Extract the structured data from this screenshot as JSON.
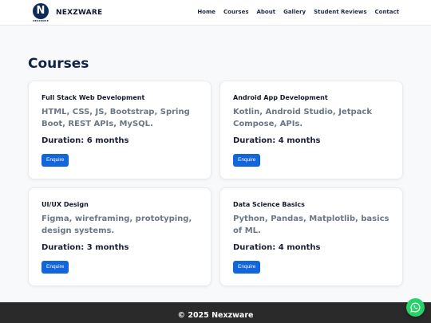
{
  "brand": {
    "logo_letter": "N",
    "logo_text": "NEXZWARE",
    "name": "NEXZWARE"
  },
  "nav": {
    "items": [
      "Home",
      "Courses",
      "About",
      "Gallery",
      "Student Reviews",
      "Contact"
    ]
  },
  "section": {
    "title": "Courses"
  },
  "courses": [
    {
      "title": "Full Stack Web Development",
      "description": "HTML, CSS, JS, Bootstrap, Spring Boot, REST APIs, MySQL.",
      "duration": "Duration: 6 months",
      "button": "Enquire"
    },
    {
      "title": "Android App Development",
      "description": "Kotlin, Android Studio, Jetpack Compose, APIs.",
      "duration": "Duration: 4 months",
      "button": "Enquire"
    },
    {
      "title": "UI/UX Design",
      "description": "Figma, wireframing, prototyping, design systems.",
      "duration": "Duration: 3 months",
      "button": "Enquire"
    },
    {
      "title": "Data Science Basics",
      "description": "Python, Pandas, Matplotlib, basics of ML.",
      "duration": "Duration: 4 months",
      "button": "Enquire"
    }
  ],
  "footer": {
    "text": "© 2025 Nexzware"
  },
  "floating": {
    "icon": "whatsapp-icon",
    "color": "#25d366"
  },
  "colors": {
    "accent": "#1266d9",
    "heading": "#0e2345",
    "footer_bg": "#2a2a2a"
  }
}
